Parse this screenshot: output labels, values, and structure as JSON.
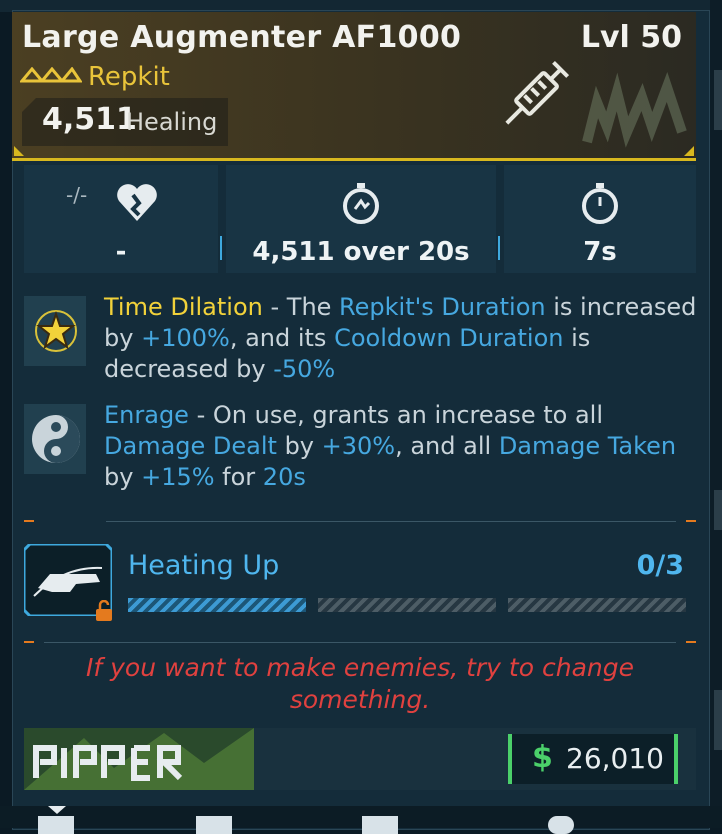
{
  "item": {
    "name": "Large Augmenter AF1000",
    "level": "Lvl 50",
    "type": "Repkit",
    "primary_stat_value": "4,511",
    "primary_stat_label": "Healing",
    "rarity_color": "#e9c43a"
  },
  "stats": [
    {
      "icon": "heart-broken-icon",
      "tag": "-/-",
      "value": "-"
    },
    {
      "icon": "stopwatch-heal-icon",
      "value": "4,511 over 20s"
    },
    {
      "icon": "stopwatch-icon",
      "value": "7s"
    }
  ],
  "perks": [
    {
      "icon": "star-burst-icon",
      "segments": [
        {
          "t": "Time Dilation",
          "c": "gold"
        },
        {
          "t": " - The ",
          "c": ""
        },
        {
          "t": "Repkit's Duration",
          "c": "blue"
        },
        {
          "t": " is increased by ",
          "c": ""
        },
        {
          "t": "+100%",
          "c": "blue"
        },
        {
          "t": ", and its ",
          "c": ""
        },
        {
          "t": "Cooldown Duration",
          "c": "blue"
        },
        {
          "t": " is decreased by ",
          "c": ""
        },
        {
          "t": "-50%",
          "c": "blue"
        }
      ]
    },
    {
      "icon": "yin-yang-icon",
      "segments": [
        {
          "t": "Enrage",
          "c": "blue"
        },
        {
          "t": " - On use, grants an increase to all ",
          "c": ""
        },
        {
          "t": "Damage Dealt",
          "c": "blue"
        },
        {
          "t": " by ",
          "c": ""
        },
        {
          "t": "+30%",
          "c": "blue"
        },
        {
          "t": ", and all ",
          "c": ""
        },
        {
          "t": "Damage Taken",
          "c": "blue"
        },
        {
          "t": " by ",
          "c": ""
        },
        {
          "t": "+15%",
          "c": "blue"
        },
        {
          "t": " for ",
          "c": ""
        },
        {
          "t": "20s",
          "c": "blue"
        }
      ]
    }
  ],
  "challenge": {
    "title": "Heating Up",
    "count": "0/3",
    "progress": 0.33
  },
  "quote": "If you want to make enemies, try to change something.",
  "footer": {
    "currency_symbol": "$",
    "price": "26,010"
  },
  "colors": {
    "accent_gold": "#d8b81f",
    "accent_blue": "#46a8e0",
    "quote_red": "#e0413f",
    "money_green": "#4bd06a"
  }
}
